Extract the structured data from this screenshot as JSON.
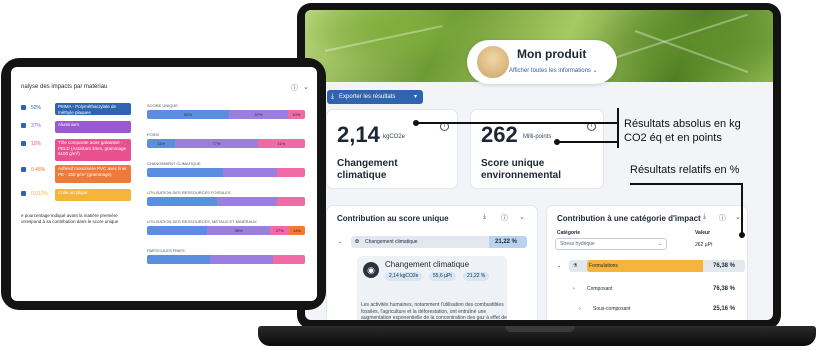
{
  "laptop": {
    "product": {
      "title": "Mon produit",
      "link": "Afficher toutes les informations"
    },
    "export_label": "Exporter les résultats",
    "card_climate": {
      "value": "2,14",
      "unit": "kgCO2e",
      "label_line1": "Changement",
      "label_line2": "climatique"
    },
    "card_score": {
      "value": "262",
      "unit": "Milli-points",
      "label_line1": "Score unique",
      "label_line2": "environnemental"
    },
    "contribution_single": {
      "title": "Contribution au score unique",
      "row_label": "Changement climatique",
      "row_value": "21,22 %",
      "detail_title": "Changement climatique",
      "badges": [
        "2,14 kgCO2e",
        "55,6 µPt",
        "21,22 %"
      ],
      "description": "Les activités humaines, notamment l'utilisation des combustibles fossiles, l'agriculture et la déforestation, ont entraîné une augmentation exponentielle de la concentration des gaz à effet de serre. Ces gaz à effet de serre favorisent"
    },
    "contribution_category": {
      "title": "Contribution à une catégorie d'impact",
      "category_label": "Catégorie",
      "value_label": "Valeur",
      "select_value": "Stress hydrique",
      "value": "262 µPt",
      "rows": [
        {
          "label": "Formulations",
          "value": "76,38 %"
        },
        {
          "label": "Composant",
          "value": "76,38 %"
        },
        {
          "label": "Sous-composant",
          "value": "25,16 %"
        }
      ]
    }
  },
  "annotations": {
    "absolute_line1": "Résultats absolus en kg",
    "absolute_line2": "CO2 éq et en points",
    "relative": "Résultats relatifs en %"
  },
  "tablet": {
    "title": "nalyse des impacts par matériau",
    "materials": [
      {
        "pct": "52%",
        "label": "PMMA - Polyméthacrylate de méthyle plaques",
        "color": "#2f64b0",
        "pct_color": "#2f64b0"
      },
      {
        "pct": "37%",
        "label": "Aluminium",
        "color": "#9b59d0",
        "pct_color": "#9b59d0"
      },
      {
        "pct": "10%",
        "label": "Tôle composite acier galvanisé - PELD (Assistant 3mm, grammage 6100 g/m²)",
        "color": "#e8508f",
        "pct_color": "#e8508f"
      },
      {
        "pct": "0.48%",
        "label": "Adhésif monomère PVC avec liner PE - 350 g/m² (grammage)",
        "color": "#f07a3a",
        "pct_color": "#f07a3a"
      },
      {
        "pct": "0.012%",
        "label": "Colle acrylique",
        "color": "#f5b43a",
        "pct_color": "#f5b43a"
      }
    ],
    "note_line1": "e pourcentage indiqué avant la matière première",
    "note_line2": "orrespond à sa contribution dans le score unique",
    "bars": [
      {
        "label": "SCORE UNIQUE",
        "segments": [
          {
            "pct": 52,
            "text": "52%",
            "color": "#5b8ee0"
          },
          {
            "pct": 37,
            "text": "37%",
            "color": "#9b7fe0"
          },
          {
            "pct": 11,
            "text": "10%",
            "color": "#f06aa5"
          }
        ]
      },
      {
        "label": "FOSSI",
        "segments": [
          {
            "pct": 18,
            "text": "11%",
            "color": "#5b8ee0"
          },
          {
            "pct": 52,
            "text": "77%",
            "color": "#9b7fe0"
          },
          {
            "pct": 30,
            "text": "11%",
            "color": "#f06aa5"
          }
        ]
      },
      {
        "label": "CHANGEMENT CLIMATIQUE",
        "segments": [
          {
            "pct": 48,
            "text": "",
            "color": "#5b8ee0"
          },
          {
            "pct": 34,
            "text": "",
            "color": "#9b7fe0"
          },
          {
            "pct": 18,
            "text": "",
            "color": "#f06aa5"
          }
        ]
      },
      {
        "label": "UTILISATION DES RESSOURCES FOSSILES",
        "segments": [
          {
            "pct": 44,
            "text": "",
            "color": "#5b8ee0"
          },
          {
            "pct": 38,
            "text": "",
            "color": "#9b7fe0"
          },
          {
            "pct": 18,
            "text": "",
            "color": "#f06aa5"
          }
        ]
      },
      {
        "label": "UTILISATION DES RESSOURCES, MÉTAUX ET MINÉRAUX",
        "segments": [
          {
            "pct": 38,
            "text": "",
            "color": "#5b8ee0"
          },
          {
            "pct": 40,
            "text": "39%",
            "color": "#9b7fe0"
          },
          {
            "pct": 12,
            "text": "27%",
            "color": "#f06aa5"
          },
          {
            "pct": 10,
            "text": "14%",
            "color": "#f07a3a"
          }
        ]
      },
      {
        "label": "PARTICULES FINES",
        "segments": [
          {
            "pct": 40,
            "text": "",
            "color": "#5b8ee0"
          },
          {
            "pct": 40,
            "text": "",
            "color": "#9b7fe0"
          },
          {
            "pct": 20,
            "text": "",
            "color": "#f06aa5"
          }
        ]
      }
    ]
  }
}
